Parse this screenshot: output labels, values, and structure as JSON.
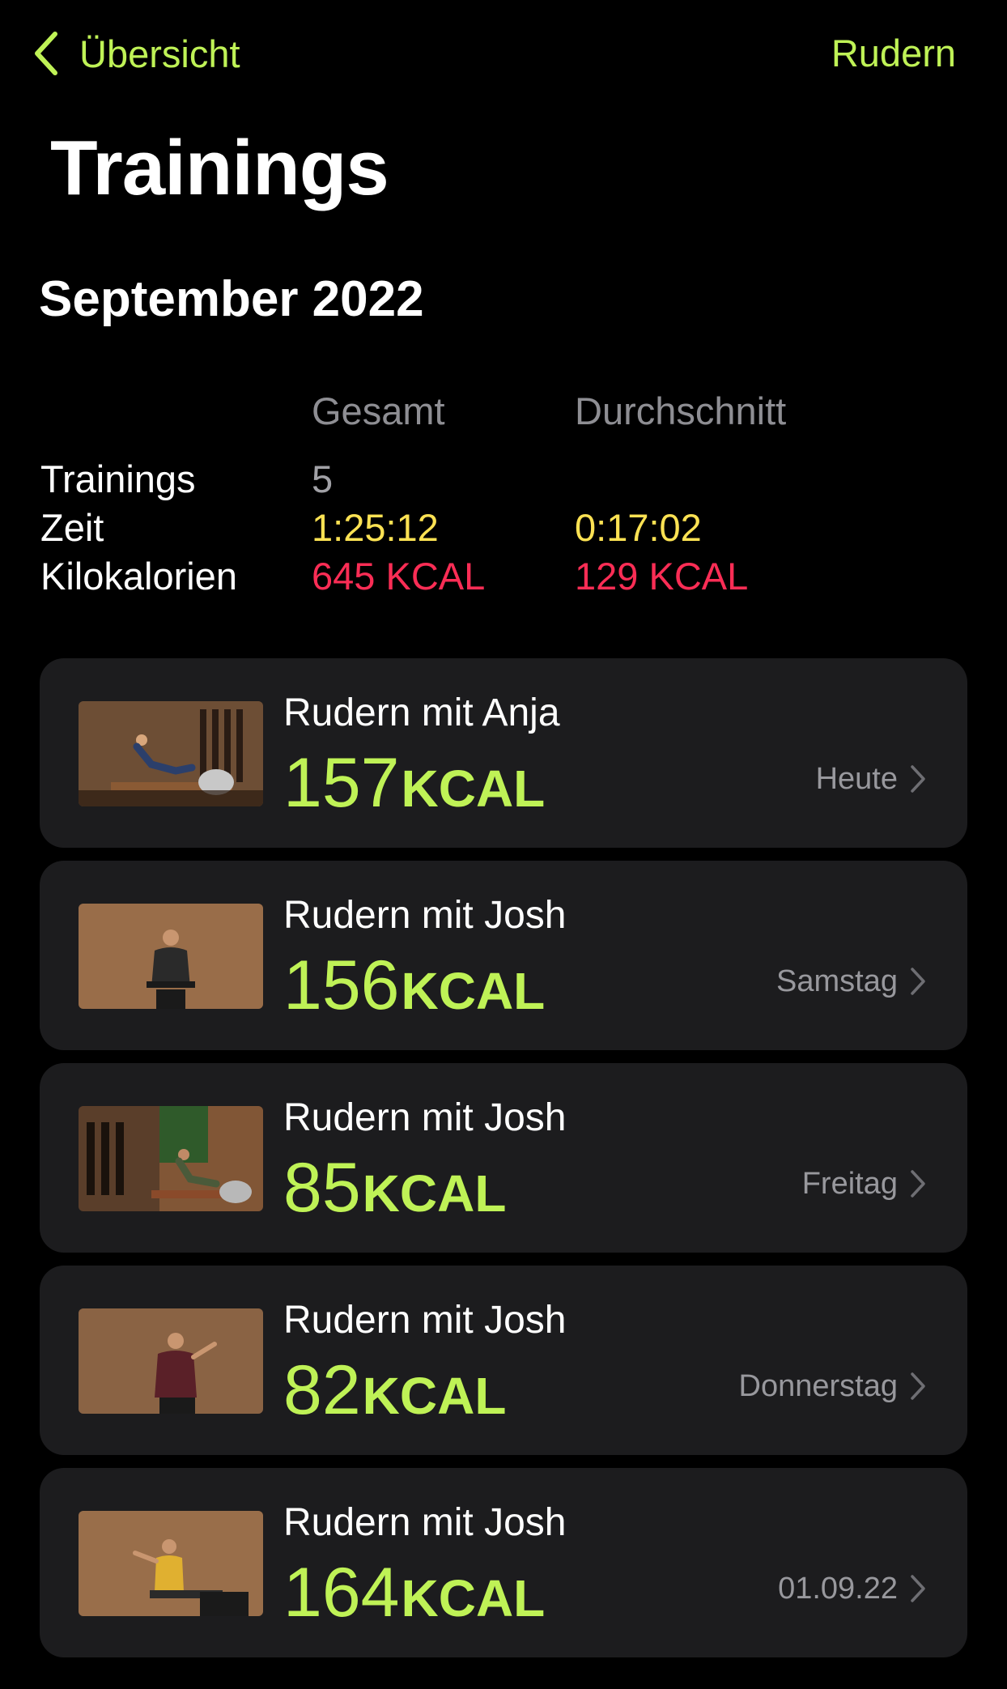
{
  "nav": {
    "back_label": "Übersicht",
    "right_label": "Rudern"
  },
  "page": {
    "title": "Trainings"
  },
  "month": {
    "title": "September 2022"
  },
  "summary": {
    "headers": {
      "total": "Gesamt",
      "average": "Durchschnitt"
    },
    "rows": [
      {
        "label": "Trainings",
        "total": "5",
        "average": ""
      },
      {
        "label": "Zeit",
        "total": "1:25:12",
        "average": "0:17:02"
      },
      {
        "label": "Kilokalorien",
        "total": "645 KCAL",
        "average": "129 KCAL"
      }
    ]
  },
  "workouts": [
    {
      "title": "Rudern mit Anja",
      "kcal": "157",
      "unit": "KCAL",
      "date": "Heute"
    },
    {
      "title": "Rudern mit Josh",
      "kcal": "156",
      "unit": "KCAL",
      "date": "Samstag"
    },
    {
      "title": "Rudern mit Josh",
      "kcal": "85",
      "unit": "KCAL",
      "date": "Freitag"
    },
    {
      "title": "Rudern mit Josh",
      "kcal": "82",
      "unit": "KCAL",
      "date": "Donnerstag"
    },
    {
      "title": "Rudern mit Josh",
      "kcal": "164",
      "unit": "KCAL",
      "date": "01.09.22"
    }
  ],
  "colors": {
    "accent": "#bff256",
    "time": "#fde253",
    "calories": "#fa2d55",
    "card_bg": "#1c1c1e",
    "background": "#000000"
  }
}
